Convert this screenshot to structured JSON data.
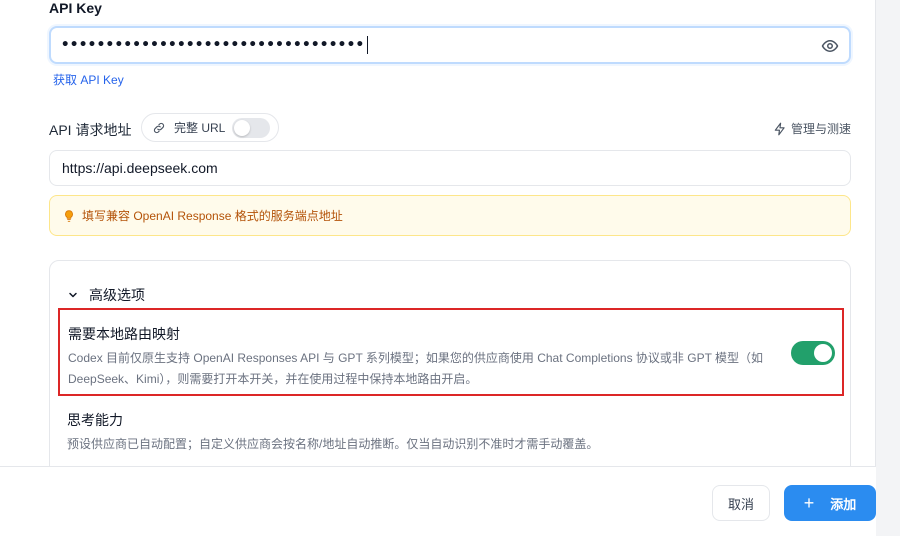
{
  "api_key": {
    "label": "API Key",
    "value": "••••••••••••••••••••••••••••••••••",
    "get_link": "获取 API Key"
  },
  "request_url": {
    "label": "API 请求地址",
    "full_url_label": "完整 URL",
    "full_url_enabled": false,
    "manage_label": "管理与测速",
    "value": "https://api.deepseek.com",
    "hint": "填写兼容 OpenAI Response 格式的服务端点地址"
  },
  "advanced": {
    "title": "高级选项",
    "expanded": true,
    "local_route": {
      "title": "需要本地路由映射",
      "description": "Codex 目前仅原生支持 OpenAI Responses API 与 GPT 系列模型；如果您的供应商使用 Chat Completions 协议或非 GPT 模型（如 DeepSeek、Kimi），则需要打开本开关，并在使用过程中保持本地路由开启。",
      "enabled": true
    },
    "thinking": {
      "title": "思考能力",
      "description": "预设供应商已自动配置；自定义供应商会按名称/地址自动推断。仅当自动识别不准时才需手动覆盖。"
    }
  },
  "footer": {
    "cancel": "取消",
    "add": "添加"
  },
  "colors": {
    "primary": "#2b8cf0",
    "toggle_on": "#22a06b",
    "highlight_border": "#dc2626",
    "hint_bg": "#fffbeb",
    "hint_text": "#b45309"
  }
}
